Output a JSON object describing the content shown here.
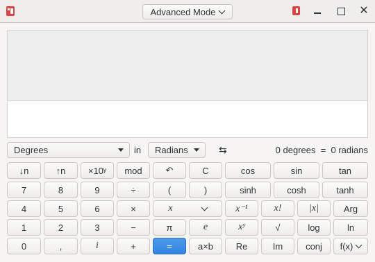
{
  "header": {
    "mode_label": "Advanced Mode"
  },
  "conversion": {
    "from_unit": "Degrees",
    "in_label": "in",
    "to_unit": "Radians",
    "swap_icon": "⇆",
    "result": "0 degrees  =  0 radians"
  },
  "keypad": {
    "r1": [
      "↓n",
      "↑n",
      "×10ʸ",
      "mod",
      "↶",
      "C",
      "cos",
      "sin",
      "tan"
    ],
    "r2": [
      "7",
      "8",
      "9",
      "÷",
      "(",
      ")",
      "sinh",
      "cosh",
      "tanh"
    ],
    "r3": [
      "4",
      "5",
      "6",
      "×",
      "x",
      "x⁻¹",
      "x!",
      "|x|",
      "Arg"
    ],
    "r4": [
      "1",
      "2",
      "3",
      "−",
      "π",
      "e",
      "xʸ",
      "√",
      "log",
      "ln"
    ],
    "r5": [
      "0",
      ",",
      "i",
      "+",
      "=",
      "a×b",
      "Re",
      "Im",
      "conj",
      "f(x)"
    ]
  },
  "colors": {
    "accent": "#3584e4",
    "app_icon": "#dd4444"
  }
}
